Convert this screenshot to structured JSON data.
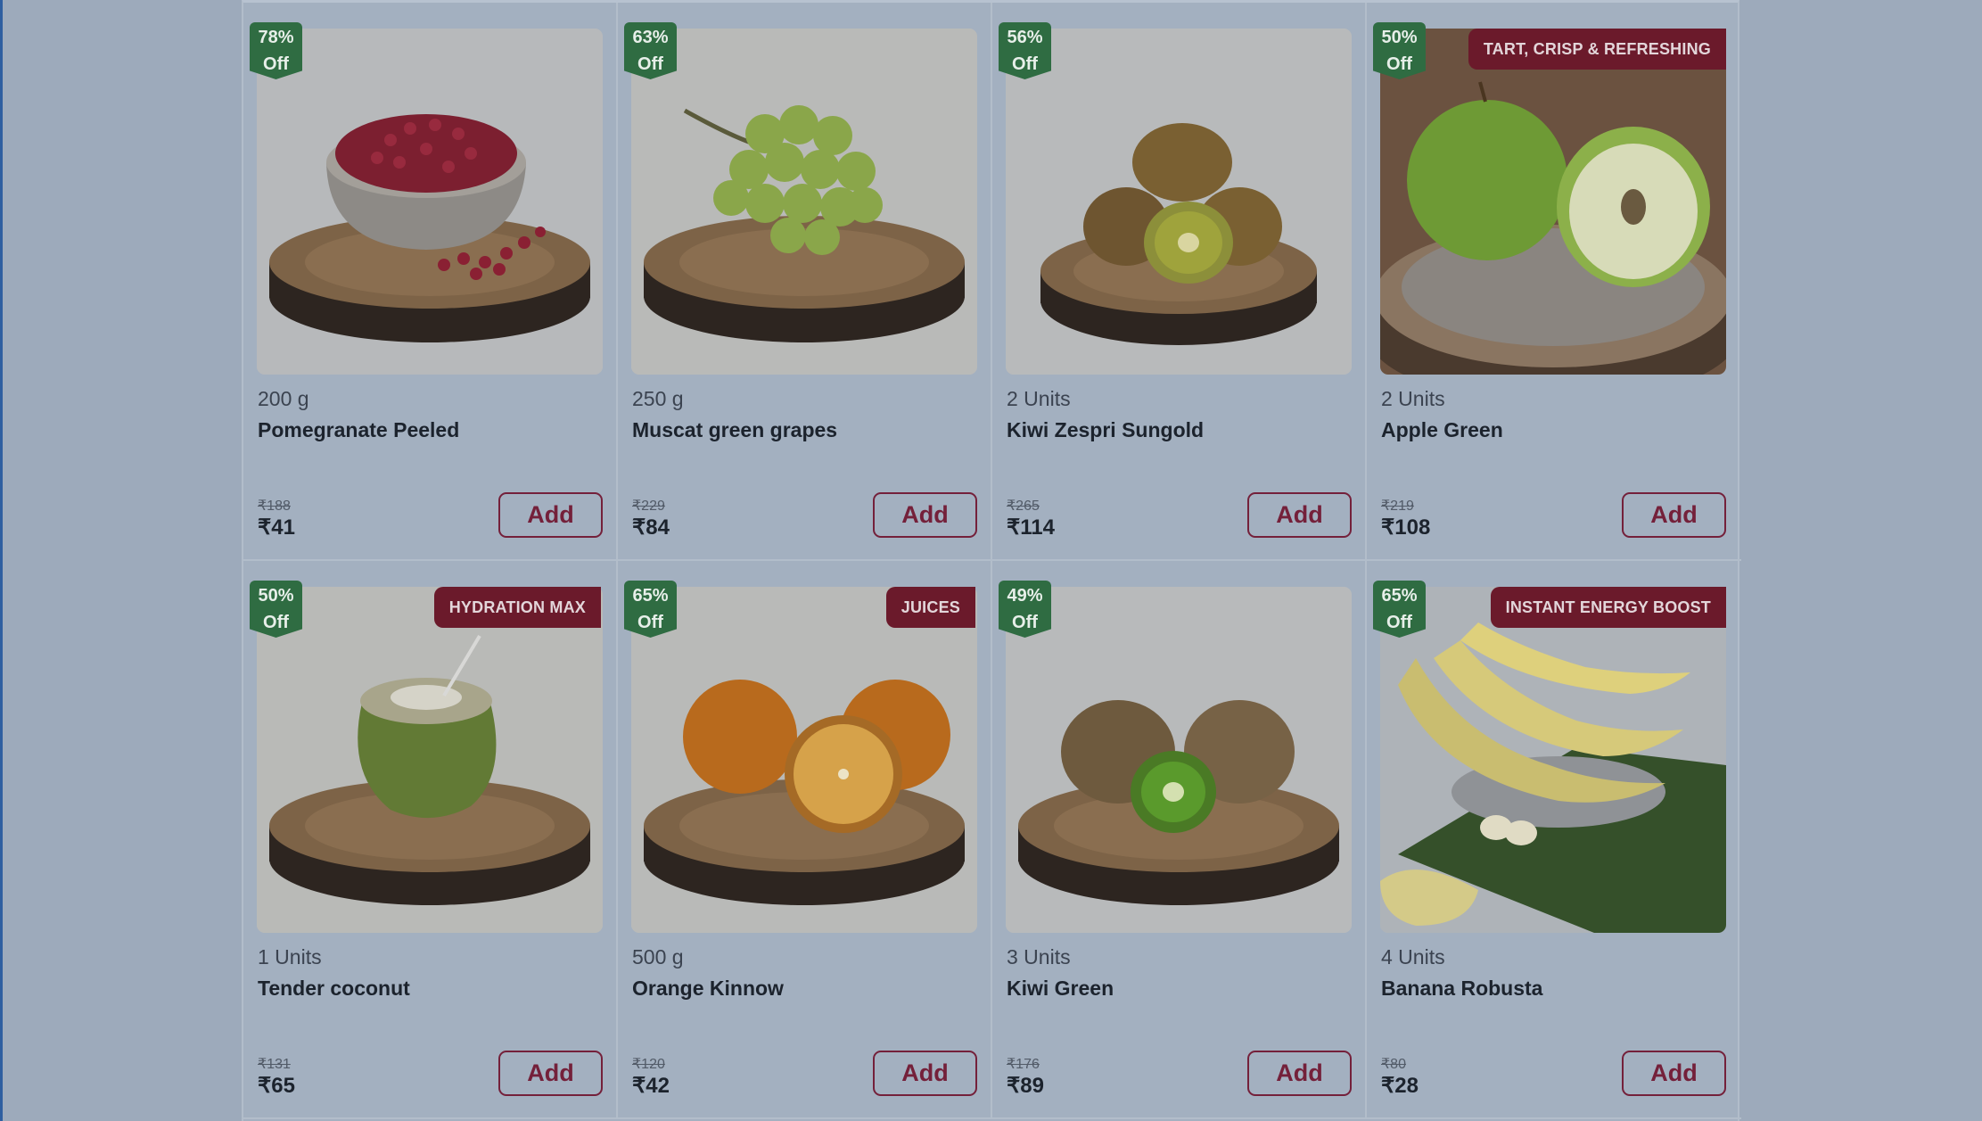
{
  "products": [
    {
      "discount_pct": "78%",
      "discount_off": "Off",
      "tag": "",
      "qty": "200 g",
      "name": "Pomegranate Peeled",
      "mrp": "₹188",
      "price": "₹41",
      "add_label": "Add",
      "image_icon": "pomegranate-image"
    },
    {
      "discount_pct": "63%",
      "discount_off": "Off",
      "tag": "",
      "qty": "250 g",
      "name": "Muscat green grapes",
      "mrp": "₹229",
      "price": "₹84",
      "add_label": "Add",
      "image_icon": "grapes-image"
    },
    {
      "discount_pct": "56%",
      "discount_off": "Off",
      "tag": "",
      "qty": "2 Units",
      "name": "Kiwi Zespri Sungold",
      "mrp": "₹265",
      "price": "₹114",
      "add_label": "Add",
      "image_icon": "kiwi-image"
    },
    {
      "discount_pct": "50%",
      "discount_off": "Off",
      "tag": "TART, CRISP & REFRESHING",
      "qty": "2 Units",
      "name": "Apple Green",
      "mrp": "₹219",
      "price": "₹108",
      "add_label": "Add",
      "image_icon": "apple-image"
    },
    {
      "discount_pct": "50%",
      "discount_off": "Off",
      "tag": "HYDRATION MAX",
      "qty": "1 Units",
      "name": "Tender coconut",
      "mrp": "₹131",
      "price": "₹65",
      "add_label": "Add",
      "image_icon": "coconut-image"
    },
    {
      "discount_pct": "65%",
      "discount_off": "Off",
      "tag": "JUICES",
      "qty": "500 g",
      "name": "Orange Kinnow",
      "mrp": "₹120",
      "price": "₹42",
      "add_label": "Add",
      "image_icon": "orange-image"
    },
    {
      "discount_pct": "49%",
      "discount_off": "Off",
      "tag": "",
      "qty": "3 Units",
      "name": "Kiwi Green",
      "mrp": "₹176",
      "price": "₹89",
      "add_label": "Add",
      "image_icon": "kiwi-image"
    },
    {
      "discount_pct": "65%",
      "discount_off": "Off",
      "tag": "INSTANT ENERGY BOOST",
      "qty": "4 Units",
      "name": "Banana Robusta",
      "mrp": "₹80",
      "price": "₹28",
      "add_label": "Add",
      "image_icon": "banana-image"
    }
  ],
  "colors": {
    "overlay_background": "#9daabb",
    "discount_badge": "#2f6c42",
    "tag_badge": "#6b1a2b",
    "add_button": "#74203a"
  }
}
